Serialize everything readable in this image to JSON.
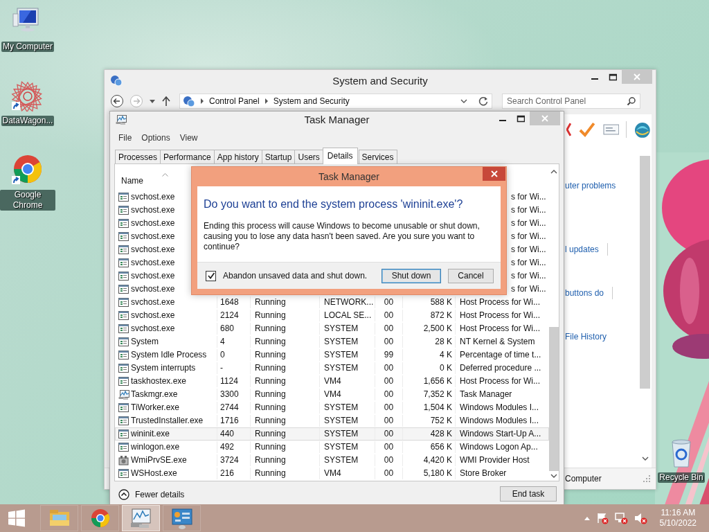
{
  "desktop": {
    "icons": [
      {
        "label": "My Computer",
        "kind": "computer",
        "shortcut": false
      },
      {
        "label": "DataWagon...",
        "kind": "star",
        "shortcut": true
      },
      {
        "label": "Google Chrome",
        "kind": "chrome",
        "shortcut": true
      },
      {
        "label": "Recycle Bin",
        "kind": "recycle",
        "shortcut": false
      }
    ]
  },
  "control_panel": {
    "title": "System and Security",
    "breadcrumb": [
      "Control Panel",
      "System and Security"
    ],
    "search": {
      "placeholder": "Search Control Panel"
    },
    "links": [
      {
        "text": "uter problems",
        "divider": false
      },
      {
        "text": "l updates",
        "divider": true
      },
      {
        "text": "buttons do",
        "divider": true
      },
      {
        "text": "File History",
        "divider": false
      }
    ],
    "status_bar": "Computer"
  },
  "task_manager": {
    "title": "Task Manager",
    "menu": [
      "File",
      "Options",
      "View"
    ],
    "tabs": [
      {
        "label": "Processes",
        "selected": false
      },
      {
        "label": "Performance",
        "selected": false
      },
      {
        "label": "App history",
        "selected": false
      },
      {
        "label": "Startup",
        "selected": false
      },
      {
        "label": "Users",
        "selected": false
      },
      {
        "label": "Details",
        "selected": true
      },
      {
        "label": "Services",
        "selected": false
      }
    ],
    "columns": [
      {
        "label": "Name",
        "sorted": true
      }
    ],
    "rows": [
      {
        "kind": "app",
        "name": "svchost.exe",
        "covered": true,
        "description": "s for Wi...",
        "selected": false
      },
      {
        "kind": "app",
        "name": "svchost.exe",
        "covered": true,
        "description": "s for Wi...",
        "selected": false
      },
      {
        "kind": "app",
        "name": "svchost.exe",
        "covered": true,
        "description": "s for Wi...",
        "selected": false
      },
      {
        "kind": "app",
        "name": "svchost.exe",
        "covered": true,
        "description": "s for Wi...",
        "selected": false
      },
      {
        "kind": "app",
        "name": "svchost.exe",
        "covered": true,
        "description": "s for Wi...",
        "selected": false
      },
      {
        "kind": "app",
        "name": "svchost.exe",
        "covered": true,
        "description": "s for Wi...",
        "selected": false
      },
      {
        "kind": "app",
        "name": "svchost.exe",
        "covered": true,
        "description": "s for Wi...",
        "selected": false
      },
      {
        "kind": "app",
        "name": "svchost.exe",
        "covered": true,
        "description": "s for Wi...",
        "selected": false
      },
      {
        "kind": "app",
        "name": "svchost.exe",
        "covered": false,
        "pid": "1648",
        "status": "Running",
        "user": "NETWORK...",
        "cpu": "00",
        "memory": "588 K",
        "description": "Host Process for Wi...",
        "selected": false
      },
      {
        "kind": "app",
        "name": "svchost.exe",
        "covered": false,
        "pid": "2124",
        "status": "Running",
        "user": "LOCAL SE...",
        "cpu": "00",
        "memory": "872 K",
        "description": "Host Process for Wi...",
        "selected": false
      },
      {
        "kind": "app",
        "name": "svchost.exe",
        "covered": false,
        "pid": "680",
        "status": "Running",
        "user": "SYSTEM",
        "cpu": "00",
        "memory": "2,500 K",
        "description": "Host Process for Wi...",
        "selected": false
      },
      {
        "kind": "app",
        "name": "System",
        "covered": false,
        "pid": "4",
        "status": "Running",
        "user": "SYSTEM",
        "cpu": "00",
        "memory": "28 K",
        "description": "NT Kernel & System",
        "selected": false
      },
      {
        "kind": "app",
        "name": "System Idle Process",
        "covered": false,
        "pid": "0",
        "status": "Running",
        "user": "SYSTEM",
        "cpu": "99",
        "memory": "4 K",
        "description": "Percentage of time t...",
        "selected": false
      },
      {
        "kind": "app",
        "name": "System interrupts",
        "covered": false,
        "pid": "-",
        "status": "Running",
        "user": "SYSTEM",
        "cpu": "00",
        "memory": "0 K",
        "description": "Deferred procedure ...",
        "selected": false
      },
      {
        "kind": "app",
        "name": "taskhostex.exe",
        "covered": false,
        "pid": "1124",
        "status": "Running",
        "user": "VM4",
        "cpu": "00",
        "memory": "1,656 K",
        "description": "Host Process for Wi...",
        "selected": false
      },
      {
        "kind": "taskmgr",
        "name": "Taskmgr.exe",
        "covered": false,
        "pid": "3300",
        "status": "Running",
        "user": "VM4",
        "cpu": "00",
        "memory": "7,352 K",
        "description": "Task Manager",
        "selected": false
      },
      {
        "kind": "app",
        "name": "TiWorker.exe",
        "covered": false,
        "pid": "2744",
        "status": "Running",
        "user": "SYSTEM",
        "cpu": "00",
        "memory": "1,504 K",
        "description": "Windows Modules I...",
        "selected": false
      },
      {
        "kind": "app",
        "name": "TrustedInstaller.exe",
        "covered": false,
        "pid": "1716",
        "status": "Running",
        "user": "SYSTEM",
        "cpu": "00",
        "memory": "752 K",
        "description": "Windows Modules I...",
        "selected": false
      },
      {
        "kind": "app",
        "name": "wininit.exe",
        "covered": false,
        "pid": "440",
        "status": "Running",
        "user": "SYSTEM",
        "cpu": "00",
        "memory": "428 K",
        "description": "Windows Start-Up A...",
        "selected": true
      },
      {
        "kind": "app",
        "name": "winlogon.exe",
        "covered": false,
        "pid": "492",
        "status": "Running",
        "user": "SYSTEM",
        "cpu": "00",
        "memory": "656 K",
        "description": "Windows Logon Ap...",
        "selected": false
      },
      {
        "kind": "wmi",
        "name": "WmiPrvSE.exe",
        "covered": false,
        "pid": "3724",
        "status": "Running",
        "user": "SYSTEM",
        "cpu": "00",
        "memory": "4,420 K",
        "description": "WMI Provider Host",
        "selected": false
      },
      {
        "kind": "app",
        "name": "WSHost.exe",
        "covered": false,
        "pid": "216",
        "status": "Running",
        "user": "VM4",
        "cpu": "00",
        "memory": "5,180 K",
        "description": "Store Broker",
        "selected": false
      }
    ],
    "fewer_details": "Fewer details",
    "end_task": "End task"
  },
  "dialog": {
    "title": "Task Manager",
    "heading": "Do you want to end the system process 'wininit.exe'?",
    "message": "Ending this process will cause Windows to become unusable or shut down, causing you to lose any data hasn't been saved. Are you sure you want to continue?",
    "checkbox": {
      "label": "Abandon unsaved data and shut down.",
      "checked": true
    },
    "buttons": [
      {
        "label": "Shut down",
        "default": true
      },
      {
        "label": "Cancel",
        "default": false
      }
    ]
  },
  "taskbar": {
    "apps": [
      {
        "kind": "explorer",
        "active": false
      },
      {
        "kind": "chrome",
        "active": false
      },
      {
        "kind": "taskmgr",
        "active": true
      },
      {
        "kind": "control",
        "active": false
      }
    ],
    "clock": {
      "time": "11:16 AM",
      "date": "5/10/2022"
    }
  }
}
